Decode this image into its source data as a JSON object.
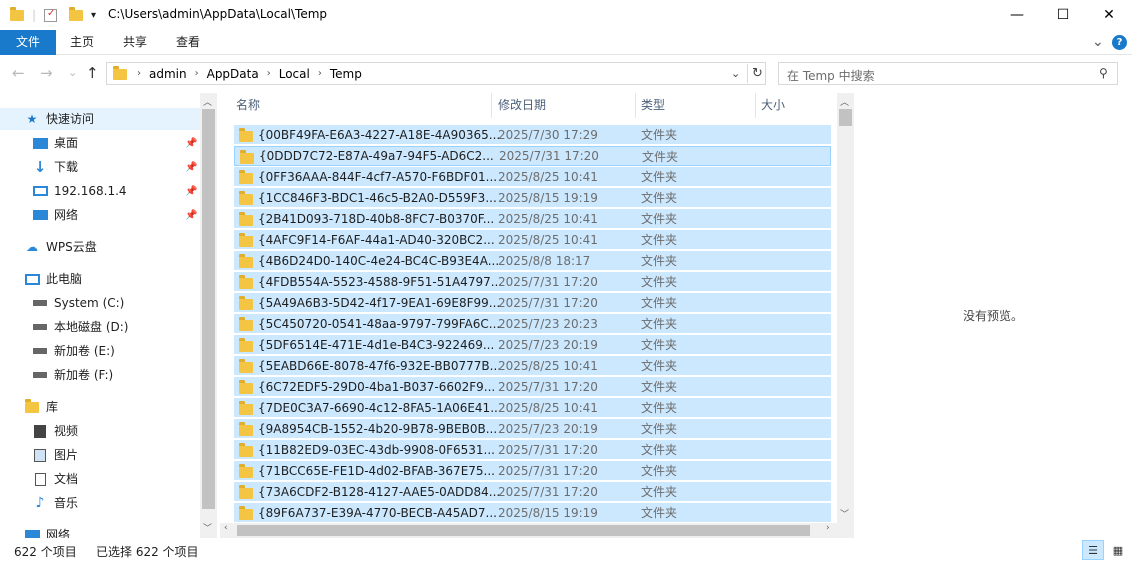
{
  "window": {
    "title_path": "C:\\Users\\admin\\AppData\\Local\\Temp",
    "minimize_glyph": "—",
    "maximize_glyph": "☐",
    "close_glyph": "✕"
  },
  "ribbon": {
    "tabs": [
      "文件",
      "主页",
      "共享",
      "查看"
    ],
    "help_glyph": "?",
    "expand_glyph": "⌄"
  },
  "nav": {
    "back_glyph": "←",
    "forward_glyph": "→",
    "recent_glyph": "⌄",
    "up_glyph": "↑",
    "breadcrumbs": [
      "admin",
      "AppData",
      "Local",
      "Temp"
    ],
    "search_placeholder": "在 Temp 中搜索"
  },
  "sidebar": {
    "quick_access": "快速访问",
    "items": [
      {
        "label": "桌面",
        "icon": "desktop-icon"
      },
      {
        "label": "下载",
        "icon": "download-icon"
      },
      {
        "label": "192.168.1.4",
        "icon": "monitor-icon"
      },
      {
        "label": "网络",
        "icon": "network-icon"
      }
    ],
    "wps": "WPS云盘",
    "this_pc": "此电脑",
    "drives": [
      "System (C:)",
      "本地磁盘 (D:)",
      "新加卷 (E:)",
      "新加卷 (F:)"
    ],
    "library": "库",
    "libs": [
      "视频",
      "图片",
      "文档",
      "音乐"
    ],
    "network": "网络"
  },
  "columns": {
    "name": "名称",
    "date": "修改日期",
    "type": "类型",
    "size": "大小"
  },
  "files": [
    {
      "name": "{00BF49FA-E6A3-4227-A18E-4A90365...",
      "date": "2025/7/30 17:29",
      "type": "文件夹"
    },
    {
      "name": "{0DDD7C72-E87A-49a7-94F5-AD6C2...",
      "date": "2025/7/31 17:20",
      "type": "文件夹"
    },
    {
      "name": "{0FF36AAA-844F-4cf7-A570-F6BDF01...",
      "date": "2025/8/25 10:41",
      "type": "文件夹"
    },
    {
      "name": "{1CC846F3-BDC1-46c5-B2A0-D559F3...",
      "date": "2025/8/15 19:19",
      "type": "文件夹"
    },
    {
      "name": "{2B41D093-718D-40b8-8FC7-B0370F...",
      "date": "2025/8/25 10:41",
      "type": "文件夹"
    },
    {
      "name": "{4AFC9F14-F6AF-44a1-AD40-320BC2...",
      "date": "2025/8/25 10:41",
      "type": "文件夹"
    },
    {
      "name": "{4B6D24D0-140C-4e24-BC4C-B93E4A...",
      "date": "2025/8/8 18:17",
      "type": "文件夹"
    },
    {
      "name": "{4FDB554A-5523-4588-9F51-51A4797...",
      "date": "2025/7/31 17:20",
      "type": "文件夹"
    },
    {
      "name": "{5A49A6B3-5D42-4f17-9EA1-69E8F99...",
      "date": "2025/7/31 17:20",
      "type": "文件夹"
    },
    {
      "name": "{5C450720-0541-48aa-9797-799FA6C...",
      "date": "2025/7/23 20:23",
      "type": "文件夹"
    },
    {
      "name": "{5DF6514E-471E-4d1e-B4C3-922469...",
      "date": "2025/7/23 20:19",
      "type": "文件夹"
    },
    {
      "name": "{5EABD66E-8078-47f6-932E-BB0777B...",
      "date": "2025/8/25 10:41",
      "type": "文件夹"
    },
    {
      "name": "{6C72EDF5-29D0-4ba1-B037-6602F9...",
      "date": "2025/7/31 17:20",
      "type": "文件夹"
    },
    {
      "name": "{7DE0C3A7-6690-4c12-8FA5-1A06E41...",
      "date": "2025/8/25 10:41",
      "type": "文件夹"
    },
    {
      "name": "{9A8954CB-1552-4b20-9B78-9BEB0B...",
      "date": "2025/7/23 20:19",
      "type": "文件夹"
    },
    {
      "name": "{11B82ED9-03EC-43db-9908-0F6531...",
      "date": "2025/7/31 17:20",
      "type": "文件夹"
    },
    {
      "name": "{71BCC65E-FE1D-4d02-BFAB-367E75...",
      "date": "2025/7/31 17:20",
      "type": "文件夹"
    },
    {
      "name": "{73A6CDF2-B128-4127-AAE5-0ADD84...",
      "date": "2025/7/31 17:20",
      "type": "文件夹"
    },
    {
      "name": "{89F6A737-E39A-4770-BECB-A45AD7...",
      "date": "2025/8/15 19:19",
      "type": "文件夹"
    }
  ],
  "preview": {
    "text": "没有预览。"
  },
  "status": {
    "count": "622 个项目",
    "selected": "已选择 622 个项目"
  },
  "colors": {
    "accent": "#1979ca",
    "selection": "#cce8ff",
    "folder": "#f4c542"
  }
}
